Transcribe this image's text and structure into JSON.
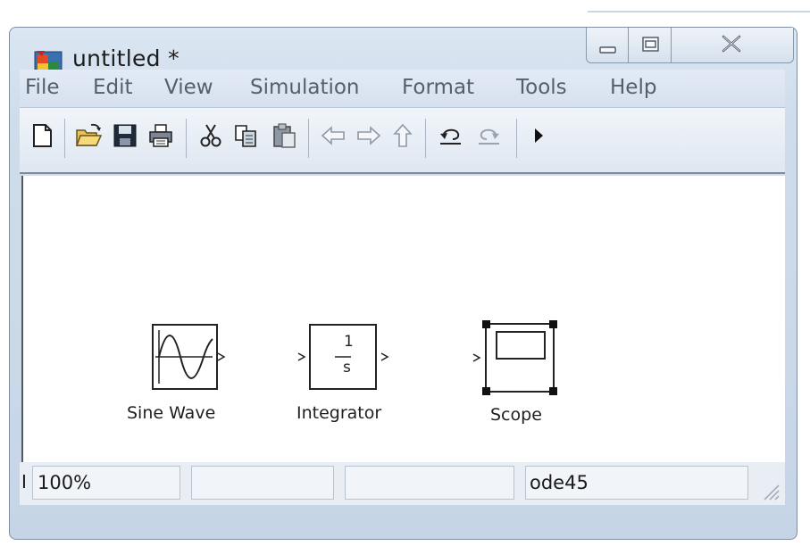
{
  "window": {
    "title": "untitled *"
  },
  "menu": {
    "items": [
      "File",
      "Edit",
      "View",
      "Simulation",
      "Format",
      "Tools",
      "Help"
    ]
  },
  "toolbar": {
    "icons": [
      "new-file-icon",
      "open-folder-icon",
      "save-icon",
      "print-icon",
      "cut-icon",
      "copy-icon",
      "paste-icon",
      "back-arrow-icon",
      "forward-arrow-icon",
      "up-arrow-icon",
      "undo-icon",
      "redo-icon",
      "start-simulation-icon"
    ]
  },
  "blocks": {
    "sine_wave": {
      "label": "Sine Wave"
    },
    "integrator": {
      "label": "Integrator",
      "numerator": "1",
      "denominator": "s"
    },
    "scope": {
      "label": "Scope"
    }
  },
  "status": {
    "left_glyph": "I",
    "zoom": "100%",
    "solver": "ode45"
  },
  "colors": {
    "chrome_blue": "#cfdceb",
    "menu_text": "#555f6b",
    "canvas": "#ffffff"
  }
}
